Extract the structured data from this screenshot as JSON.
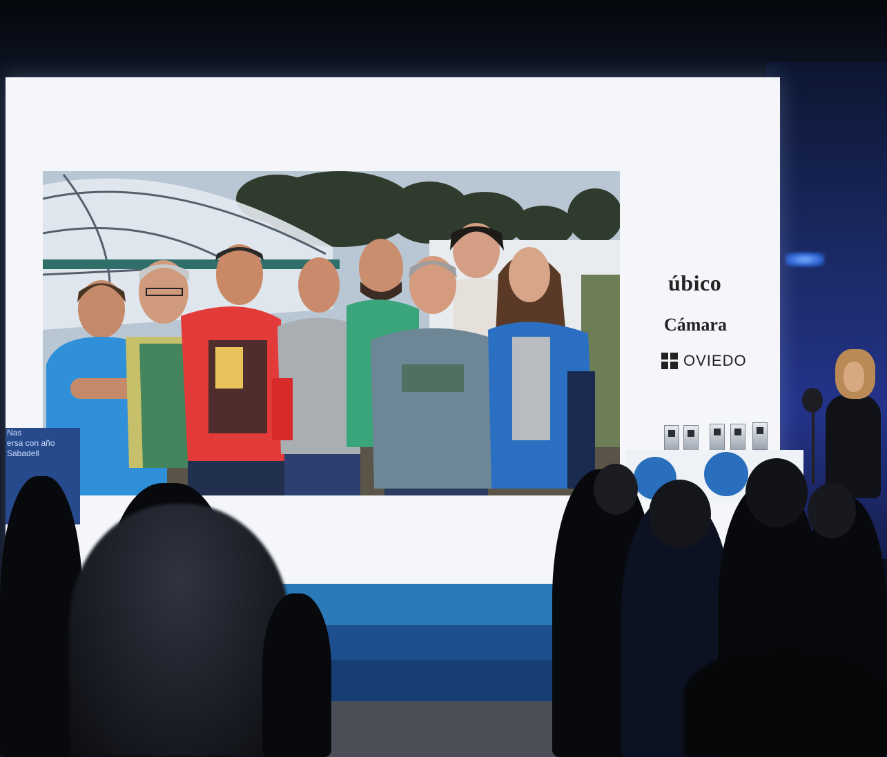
{
  "screen": {
    "logos": {
      "ubico": "úbico",
      "camara": "Cámara",
      "oviedo": "OVIEDO"
    },
    "left_banner_lines": [
      "Nas",
      "ersa con año",
      "Sabadell"
    ]
  },
  "colors": {
    "screen_white": "#f4f6fa",
    "stage_blue": "#2b7ab7",
    "podium_dot_blue": "#2a6fbd",
    "wall_blue": "#24338a"
  },
  "icons": [
    "oviedo-logo-icon",
    "trophy-icon",
    "microphone-icon"
  ]
}
